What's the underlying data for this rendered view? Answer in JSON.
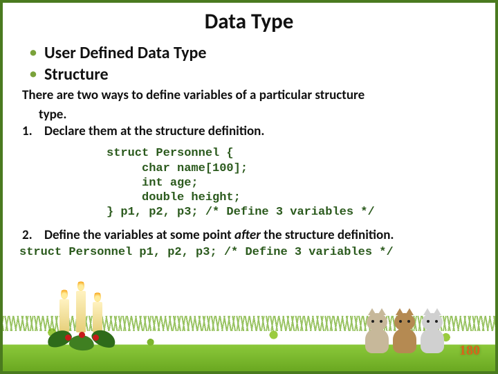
{
  "title": "Data Type",
  "bullets": [
    {
      "label": "User Defined Data Type"
    },
    {
      "label": "Structure"
    }
  ],
  "intro": {
    "line1": "There are two ways to define variables of a particular structure",
    "line2": "type."
  },
  "items": [
    {
      "num": "1.",
      "text": "Declare them at the structure definition.",
      "code": "struct Personnel {\n     char name[100];\n     int age;\n     double height;\n} p1, p2, p3; /* Define 3 variables */"
    },
    {
      "num": "2.",
      "text_before": "Define the variables at some point ",
      "text_italic": "after",
      "text_after": " the structure definition.",
      "code": "struct Personnel p1, p2, p3; /* Define 3 variables */"
    }
  ],
  "page": "180"
}
